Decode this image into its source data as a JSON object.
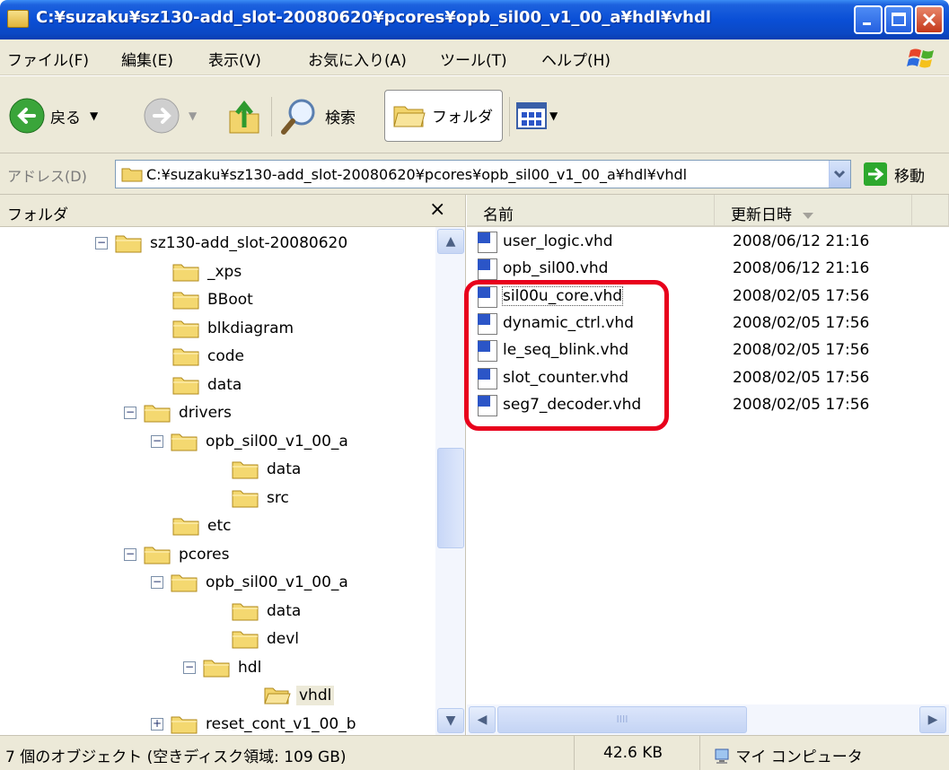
{
  "window": {
    "title": "C:¥suzaku¥sz130-add_slot-20080620¥pcores¥opb_sil00_v1_00_a¥hdl¥vhdl"
  },
  "menu": {
    "items": [
      "ファイル(F)",
      "編集(E)",
      "表示(V)",
      "お気に入り(A)",
      "ツール(T)",
      "ヘルプ(H)"
    ]
  },
  "toolbar": {
    "back_label": "戻る",
    "search_label": "検索",
    "folders_label": "フォルダ"
  },
  "address": {
    "label": "アドレス(D)",
    "value": "C:¥suzaku¥sz130-add_slot-20080620¥pcores¥opb_sil00_v1_00_a¥hdl¥vhdl",
    "go_label": "移動"
  },
  "folder_pane": {
    "title": "フォルダ",
    "close_glyph": "×",
    "tree": [
      {
        "label": "sz130-add_slot-20080620",
        "expander": "−"
      },
      {
        "label": "_xps",
        "expander": ""
      },
      {
        "label": "BBoot",
        "expander": ""
      },
      {
        "label": "blkdiagram",
        "expander": ""
      },
      {
        "label": "code",
        "expander": ""
      },
      {
        "label": "data",
        "expander": ""
      },
      {
        "label": "drivers",
        "expander": "−"
      },
      {
        "label": "opb_sil00_v1_00_a",
        "expander": "−"
      },
      {
        "label": "data",
        "expander": ""
      },
      {
        "label": "src",
        "expander": ""
      },
      {
        "label": "etc",
        "expander": ""
      },
      {
        "label": "pcores",
        "expander": "−"
      },
      {
        "label": "opb_sil00_v1_00_a",
        "expander": "−"
      },
      {
        "label": "data",
        "expander": ""
      },
      {
        "label": "devl",
        "expander": ""
      },
      {
        "label": "hdl",
        "expander": "−"
      },
      {
        "label": "vhdl",
        "expander": "",
        "selected": true
      },
      {
        "label": "reset_cont_v1_00_b",
        "expander": "+"
      }
    ]
  },
  "file_list": {
    "columns": {
      "name": "名前",
      "modified": "更新日時"
    },
    "files": [
      {
        "name": "user_logic.vhd",
        "modified": "2008/06/12 21:16"
      },
      {
        "name": "opb_sil00.vhd",
        "modified": "2008/06/12 21:16"
      },
      {
        "name": "sil00u_core.vhd",
        "modified": "2008/02/05 17:56"
      },
      {
        "name": "dynamic_ctrl.vhd",
        "modified": "2008/02/05 17:56"
      },
      {
        "name": "le_seq_blink.vhd",
        "modified": "2008/02/05 17:56"
      },
      {
        "name": "slot_counter.vhd",
        "modified": "2008/02/05 17:56"
      },
      {
        "name": "seg7_decoder.vhd",
        "modified": "2008/02/05 17:56"
      }
    ]
  },
  "status": {
    "objects": "7 個のオブジェクト (空きディスク領域: 109 GB)",
    "size": "42.6 KB",
    "location": "マイ コンピュータ"
  },
  "colors": {
    "titlebar": "#0a4fd6",
    "highlight_ring": "#e8001c",
    "chrome": "#ece9d8"
  }
}
